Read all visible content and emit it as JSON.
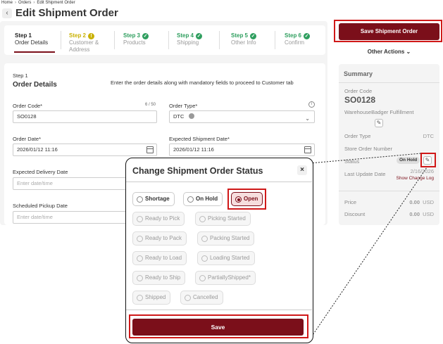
{
  "breadcrumb": {
    "home": "Home",
    "orders": "Orders",
    "current": "Edit Shipment Order",
    "sep": "›"
  },
  "header": {
    "back_icon": "‹",
    "title": "Edit Shipment Order"
  },
  "stepper": {
    "steps": [
      {
        "num": "Step 1",
        "label": "Order Details",
        "status": "active"
      },
      {
        "num": "Step 2",
        "label": "Customer & Address",
        "status": "warning"
      },
      {
        "num": "Step 3",
        "label": "Products",
        "status": "done"
      },
      {
        "num": "Step 4",
        "label": "Shipping",
        "status": "done"
      },
      {
        "num": "Step 5",
        "label": "Other Info",
        "status": "done"
      },
      {
        "num": "Step 6",
        "label": "Confirm",
        "status": "done"
      }
    ],
    "warning_glyph": "!",
    "done_glyph": "✓"
  },
  "form": {
    "step_num": "Step 1",
    "step_title": "Order Details",
    "hint": "Enter the order details along with mandatory fields to proceed to Customer tab",
    "order_code": {
      "label": "Order Code*",
      "counter": "6 / 50",
      "value": "SO0128"
    },
    "order_type": {
      "label": "Order Type*",
      "value": "DTC",
      "info_icon": "i",
      "chevron": "⌄"
    },
    "order_date": {
      "label": "Order Date*",
      "value": "2026/01/12 11:16"
    },
    "expected_shipment_date": {
      "label": "Expected Shipment Date*",
      "value": "2026/01/12 11:16"
    },
    "expected_delivery_date": {
      "label": "Expected Delivery Date",
      "placeholder": "Enter date/time"
    },
    "scheduled_pickup_date": {
      "label": "Scheduled Pickup Date",
      "placeholder": "Enter date/time"
    }
  },
  "sidebar": {
    "save_label": "Save Shipment Order",
    "other_actions_label": "Other Actions ⌄",
    "summary": {
      "title": "Summary",
      "order_code_label": "Order Code",
      "order_code_value": "SO0128",
      "warehouse": "WarehouseBadger Fulfillment",
      "order_type_label": "Order Type",
      "order_type_value": "DTC",
      "store_order_label": "Store Order Number",
      "status_label": "Status",
      "status_value": "On Hold",
      "last_update_label": "Last Update Date",
      "last_update_value": "2/16/2026",
      "show_change_log": "Show Change Log",
      "price_label": "Price",
      "price_value": "0.00",
      "price_currency": "USD",
      "discount_label": "Discount",
      "discount_value": "0.00",
      "discount_currency": "USD"
    }
  },
  "modal": {
    "title": "Change Shipment Order Status",
    "close_glyph": "×",
    "options": [
      {
        "label": "Shortage",
        "state": "enabled"
      },
      {
        "label": "On Hold",
        "state": "enabled"
      },
      {
        "label": "Open",
        "state": "selected"
      },
      {
        "label": "Ready to Pick",
        "state": "disabled"
      },
      {
        "label": "Picking Started",
        "state": "disabled"
      },
      {
        "label": "Ready to Pack",
        "state": "disabled"
      },
      {
        "label": "Packing Started",
        "state": "disabled"
      },
      {
        "label": "Ready to Load",
        "state": "disabled"
      },
      {
        "label": "Loading Started",
        "state": "disabled"
      },
      {
        "label": "Ready to Ship",
        "state": "disabled"
      },
      {
        "label": "PartiallyShipped*",
        "state": "disabled"
      },
      {
        "label": "Shipped",
        "state": "disabled"
      },
      {
        "label": "Cancelled",
        "state": "disabled"
      }
    ],
    "save_label": "Save"
  },
  "colors": {
    "brand": "#7b0f1a",
    "highlight": "#d01818",
    "success": "#2e9e5e",
    "warning": "#c9b100"
  }
}
